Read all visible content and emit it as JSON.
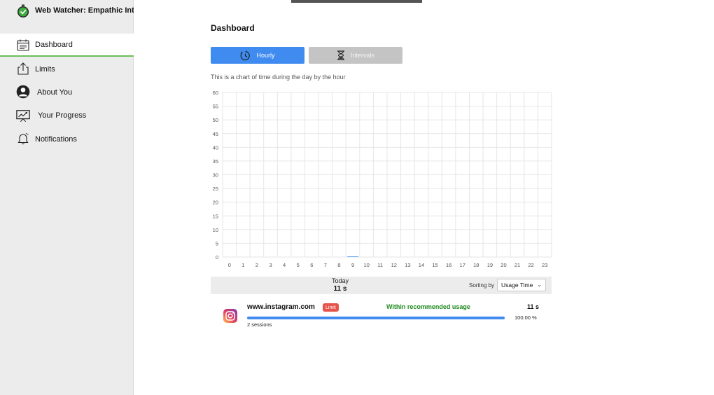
{
  "app": {
    "title": "Web Watcher: Empathic Interventions"
  },
  "sidebar": {
    "items": [
      {
        "label": "Dashboard",
        "icon": "calendar-icon",
        "active": true
      },
      {
        "label": "Limits",
        "icon": "upload-icon",
        "active": false
      },
      {
        "label": "About You",
        "icon": "user-icon",
        "active": false
      },
      {
        "label": "Your Progress",
        "icon": "presentation-chart-icon",
        "active": false
      },
      {
        "label": "Notifications",
        "icon": "bell-icon",
        "active": false
      }
    ]
  },
  "main": {
    "title": "Dashboard",
    "tabs": [
      {
        "label": "Hourly",
        "icon": "clock-icon",
        "active": true
      },
      {
        "label": "Intervals",
        "icon": "hourglass-icon",
        "active": false
      }
    ],
    "chart_description": "This is a chart of time during the day by the hour"
  },
  "chart_data": {
    "type": "bar",
    "categories": [
      "0",
      "1",
      "2",
      "3",
      "4",
      "5",
      "6",
      "7",
      "8",
      "9",
      "10",
      "11",
      "12",
      "13",
      "14",
      "15",
      "16",
      "17",
      "18",
      "19",
      "20",
      "21",
      "22",
      "23"
    ],
    "values": [
      0,
      0,
      0,
      0,
      0,
      0,
      0,
      0,
      0,
      0.2,
      0,
      0,
      0,
      0,
      0,
      0,
      0,
      0,
      0,
      0,
      0,
      0,
      0,
      0
    ],
    "yticks": [
      "0",
      "5",
      "10",
      "15",
      "20",
      "25",
      "30",
      "35",
      "40",
      "45",
      "50",
      "55",
      "60"
    ],
    "ylim": [
      0,
      60
    ],
    "grid": true,
    "bar_color": "#3f8bf0"
  },
  "summary": {
    "today_label": "Today",
    "today_total": "11 s",
    "sort_label": "Sorting by",
    "sort_value": "Usage Time"
  },
  "sites": [
    {
      "name": "www.instagram.com",
      "badge": "Limit",
      "status": "Within recommended usage",
      "time": "11 s",
      "percent_text": "100.00 %",
      "percent": 100,
      "sessions": "2 sessions",
      "icon": "instagram-icon"
    }
  ],
  "colors": {
    "accent": "#3f8bf0",
    "active_underline": "#6dbf5c",
    "ok_status": "#1f8b1f",
    "limit_badge": "#e5534b"
  }
}
